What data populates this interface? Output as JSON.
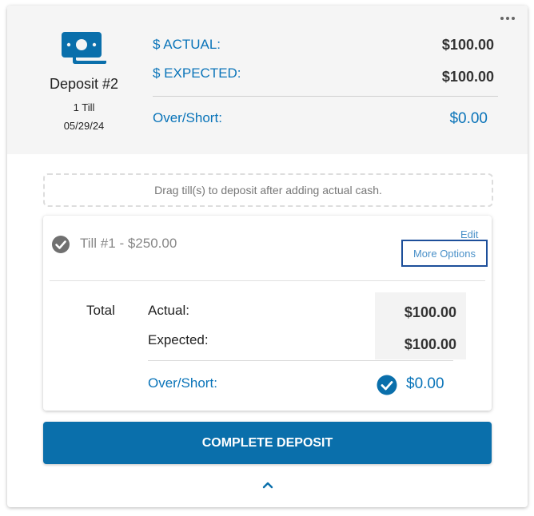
{
  "deposit": {
    "title": "Deposit #2",
    "till_count": "1 Till",
    "date": "05/29/24",
    "actual_label": "$ ACTUAL:",
    "actual_value": "$100.00",
    "expected_label": "$ EXPECTED:",
    "expected_value": "$100.00",
    "over_short_label": "Over/Short:",
    "over_short_value": "$0.00"
  },
  "dropzone": {
    "text": "Drag till(s) to deposit after adding actual cash."
  },
  "till": {
    "label": "Till #1 - $250.00",
    "edit_label": "Edit",
    "more_options_label": "More Options",
    "total_label": "Total",
    "actual_label": "Actual:",
    "actual_value": "$100.00",
    "expected_label": "Expected:",
    "expected_value": "$100.00",
    "over_short_label": "Over/Short:",
    "over_short_value": "$0.00"
  },
  "actions": {
    "complete_label": "COMPLETE DEPOSIT"
  },
  "icons": {
    "menu": "more-horizontal-icon",
    "cash": "cash-icon",
    "till_status": "check-circle-icon",
    "over_short_status": "check-circle-icon",
    "collapse": "chevron-up-icon"
  },
  "colors": {
    "accent": "#0a74b9",
    "button": "#0a6fab",
    "highlight_border": "#1d4f9a"
  }
}
